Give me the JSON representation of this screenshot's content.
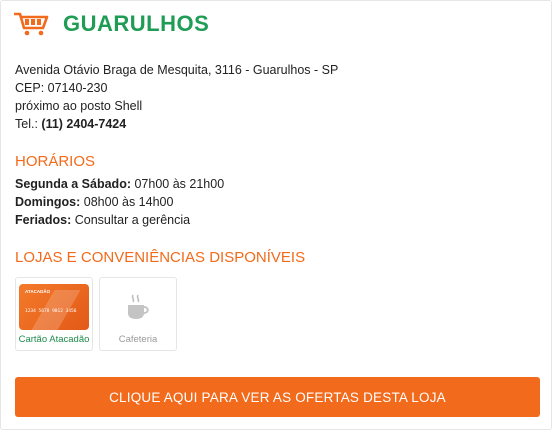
{
  "store": {
    "name": "GUARULHOS",
    "address_line": "Avenida Otávio Braga de Mesquita, 3116 - Guarulhos - SP",
    "cep": "CEP: 07140-230",
    "reference": "próximo ao posto Shell",
    "tel_label": "Tel.:",
    "tel_number": "(11) 2404-7424"
  },
  "hours": {
    "title": "HORÁRIOS",
    "rows": [
      {
        "label": "Segunda a Sábado:",
        "value": "07h00 às 21h00"
      },
      {
        "label": "Domingos:",
        "value": "08h00 às 14h00"
      },
      {
        "label": "Feriados:",
        "value": "Consultar a gerência"
      }
    ]
  },
  "services": {
    "title": "LOJAS E CONVENIÊNCIAS DISPONÍVEIS",
    "items": [
      {
        "label": "Cartão Atacadão",
        "icon": "credit-card-icon",
        "card_brand": "ATACADÃO",
        "card_number": "1234 5678 9012 3456"
      },
      {
        "label": "Cafeteria",
        "icon": "coffee-cup-icon"
      }
    ]
  },
  "cta": {
    "label": "CLIQUE AQUI PARA VER AS OFERTAS DESTA LOJA"
  },
  "colors": {
    "accent": "#f26a1b",
    "brand_green": "#1f9d55"
  }
}
